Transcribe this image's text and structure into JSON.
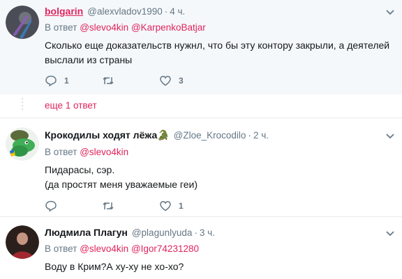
{
  "tweets": [
    {
      "name": "bolgarin",
      "handle": "@alexvladov1990",
      "time": "4 ч.",
      "reply_prefix": "В ответ",
      "mentions": [
        "@slevo4kin",
        "@KarpenkoBatjar"
      ],
      "text_lines": [
        "Сколько еще доказательств нужнл, что бы эту контору закрыли, а деятелей",
        "выслали из страны"
      ],
      "reply_count": "1",
      "retweet_count": "",
      "like_count": "3"
    },
    {
      "name": "Крокодилы ходят лёжа🐊",
      "handle": "@Zloe_Krocodilo",
      "time": "2 ч.",
      "reply_prefix": "В ответ",
      "mentions": [
        "@slevo4kin"
      ],
      "text_lines": [
        "Пидарасы, сэр.",
        "(да простят меня уважаемые геи)"
      ],
      "reply_count": "",
      "retweet_count": "",
      "like_count": "1"
    },
    {
      "name": "Людмила Плагун",
      "handle": "@plagunlyuda",
      "time": "3 ч.",
      "reply_prefix": "В ответ",
      "mentions": [
        "@slevo4kin",
        "@Igor74231280"
      ],
      "text_lines": [
        "Воду в Крим?А ху-ху не хо-хо?"
      ]
    }
  ],
  "more_replies_label": "еще 1 ответ",
  "separator_dot": "·",
  "colors": {
    "accent": "#e0245e",
    "muted": "#657786",
    "highlight_bg": "#f5f8fa",
    "divider": "#e6ecf0"
  },
  "icons": [
    "reply-icon",
    "retweet-icon",
    "like-icon",
    "caret-down-icon"
  ]
}
